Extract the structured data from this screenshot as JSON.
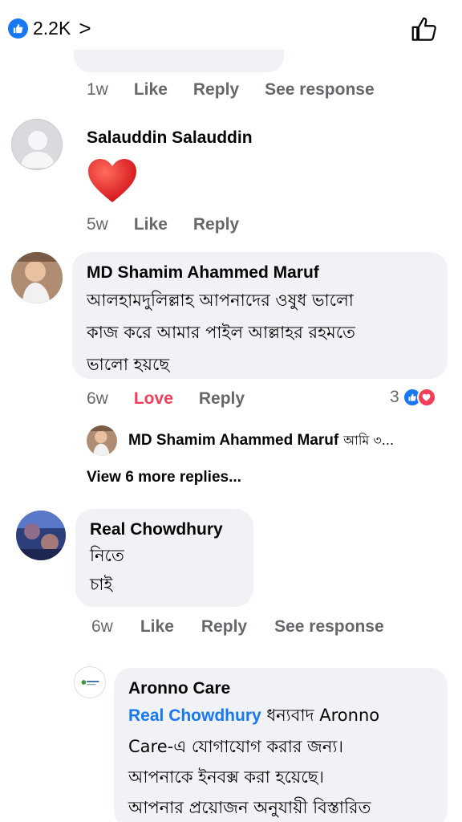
{
  "header": {
    "reaction_count": "2.2K",
    "chevron": ">",
    "like_icon": "thumbs-up-outline-icon",
    "badge_icon": "like-badge-icon"
  },
  "comments": [
    {
      "meta": {
        "time": "1w",
        "like": "Like",
        "reply": "Reply",
        "see_response": "See response"
      }
    },
    {
      "name": "Salauddin Salauddin",
      "body_icon": "red-heart-emoji",
      "meta": {
        "time": "5w",
        "like": "Like",
        "reply": "Reply"
      }
    },
    {
      "name": "MD Shamim Ahammed Maruf",
      "lines": [
        "আলহামদুলিল্লাহ আপনাদের ওষুধ ভালো",
        "কাজ করে আমার পাইল আল্লাহর রহমতে",
        "ভালো হয়ছে"
      ],
      "meta": {
        "time": "6w",
        "like": "Love",
        "reply": "Reply"
      },
      "reaction_count": "3",
      "reply_preview": {
        "name": "MD Shamim Ahammed Maruf",
        "text": "আমি ৩..."
      },
      "view_more": "View 6 more replies..."
    },
    {
      "name": "Real Chowdhury",
      "lines": [
        "নিতে",
        "চাই"
      ],
      "meta": {
        "time": "6w",
        "like": "Like",
        "reply": "Reply",
        "see_response": "See response"
      }
    },
    {
      "name": "Aronno Care",
      "mention": "Real Chowdhury",
      "first_line_rest": " ধন্যবাদ Aronno",
      "lines": [
        "Care-এ যোগাযোগ করার জন্য।",
        "আপনাকে ইনবক্স করা হয়েছে।",
        "আপনার প্রয়োজন অনুযায়ী বিস্তারিত"
      ]
    }
  ],
  "colors": {
    "accent": "#1877f2",
    "love": "#f33e58",
    "bubble": "#f0f2f5",
    "meta": "#65676b"
  }
}
